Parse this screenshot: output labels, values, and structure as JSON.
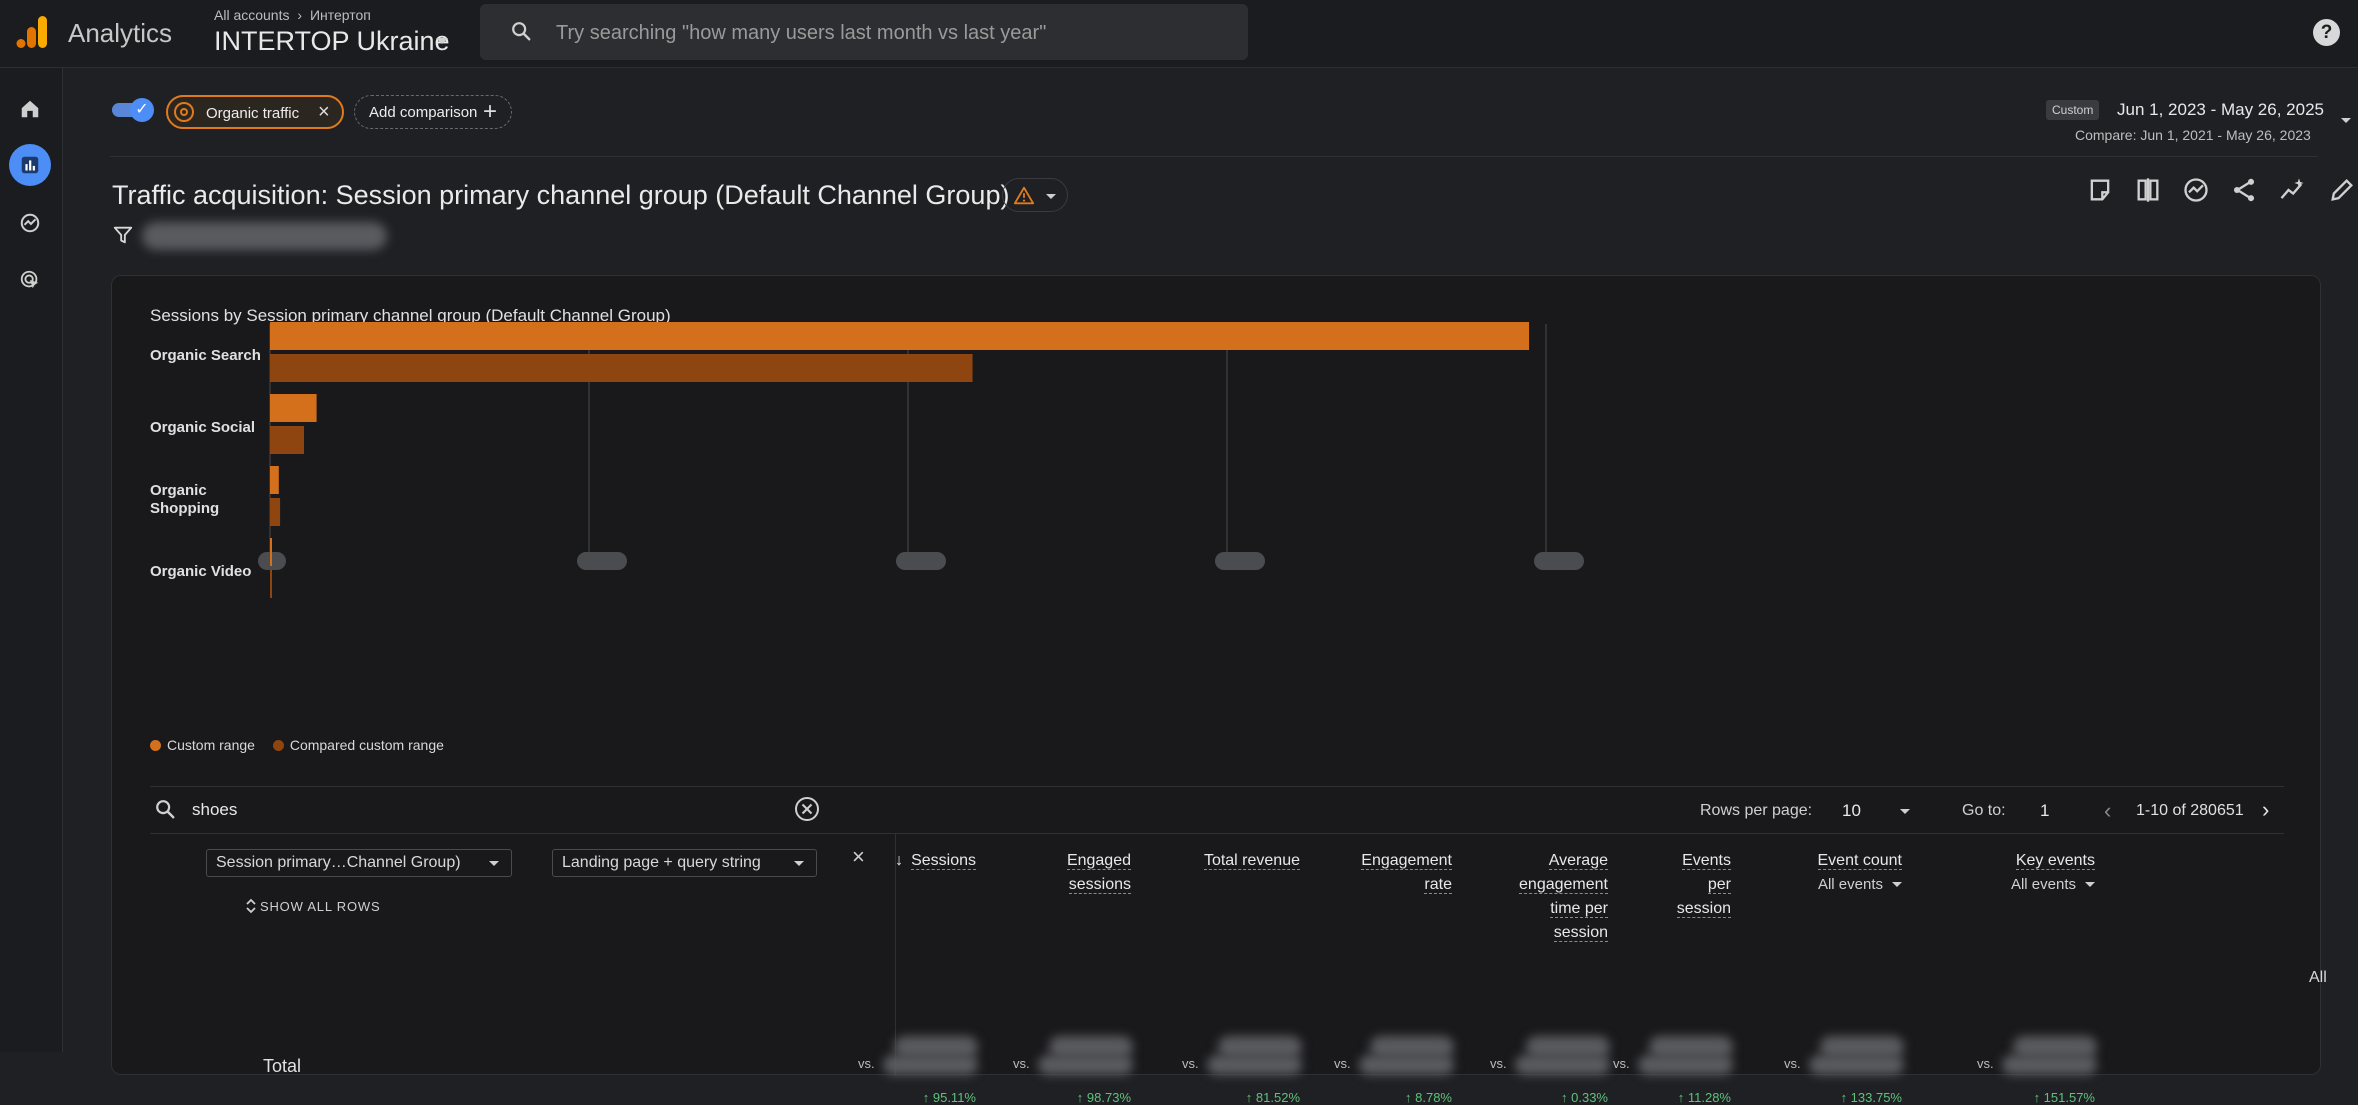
{
  "topbar": {
    "app_name": "Analytics",
    "breadcrumb_root": "All accounts",
    "breadcrumb_account": "Интертоп",
    "property_name": "INTERTOP Ukraine",
    "search_placeholder": "Try searching \"how many users last month vs last year\"",
    "help_label": "?"
  },
  "nav": [
    "home-icon",
    "reports-icon",
    "explore-icon",
    "advertising-icon"
  ],
  "comparison": {
    "segment_label": "Organic traffic",
    "add_label": "Add comparison"
  },
  "date": {
    "badge": "Custom",
    "range": "Jun 1, 2023 - May 26, 2025",
    "compare": "Compare: Jun 1, 2021 - May 26, 2023"
  },
  "report": {
    "title": "Traffic acquisition: Session primary channel group (Default Channel Group)"
  },
  "chart_data": {
    "type": "bar",
    "orientation": "horizontal",
    "title": "Sessions by Session primary channel group (Default Channel Group)",
    "categories": [
      "Organic Search",
      "Organic Social",
      "Organic Shopping",
      "Organic Video"
    ],
    "series": [
      {
        "name": "Custom range",
        "color": "#d4701c",
        "values": [
          100,
          3.7,
          0.7,
          0.15
        ]
      },
      {
        "name": "Compared custom range",
        "color": "#8e4510",
        "values": [
          55.8,
          2.7,
          0.8,
          0.1
        ]
      }
    ],
    "xlim": [
      0,
      105
    ],
    "grid": true,
    "legend": "bottom-left"
  },
  "table": {
    "search_value": "shoes",
    "rows_per_page_label": "Rows per page:",
    "rows_per_page": "10",
    "goto_label": "Go to:",
    "goto_value": "1",
    "page_range": "1-10 of 280651",
    "dim1": "Session primary…Channel Group)",
    "dim2": "Landing page + query string",
    "show_all_rows": "SHOW ALL ROWS",
    "all_label": "All",
    "total_label": "Total",
    "vs_label": "vs.",
    "metrics": [
      {
        "lines": [
          "Sessions"
        ],
        "sub": "",
        "delta": "↑ 95.11%"
      },
      {
        "lines": [
          "Engaged",
          "sessions"
        ],
        "sub": "",
        "delta": "↑ 98.73%"
      },
      {
        "lines": [
          "Total revenue"
        ],
        "sub": "",
        "delta": "↑ 81.52%"
      },
      {
        "lines": [
          "Engagement",
          "rate"
        ],
        "sub": "",
        "delta": "↑ 8.78%"
      },
      {
        "lines": [
          "Average",
          "engagement",
          "time per",
          "session"
        ],
        "sub": "",
        "delta": "↑ 0.33%"
      },
      {
        "lines": [
          "Events",
          "per",
          "session"
        ],
        "sub": "",
        "delta": "↑ 11.28%"
      },
      {
        "lines": [
          "Event count"
        ],
        "sub": "All events",
        "delta": "↑ 133.75%"
      },
      {
        "lines": [
          "Key events"
        ],
        "sub": "All events",
        "delta": "↑ 151.57%"
      }
    ]
  }
}
